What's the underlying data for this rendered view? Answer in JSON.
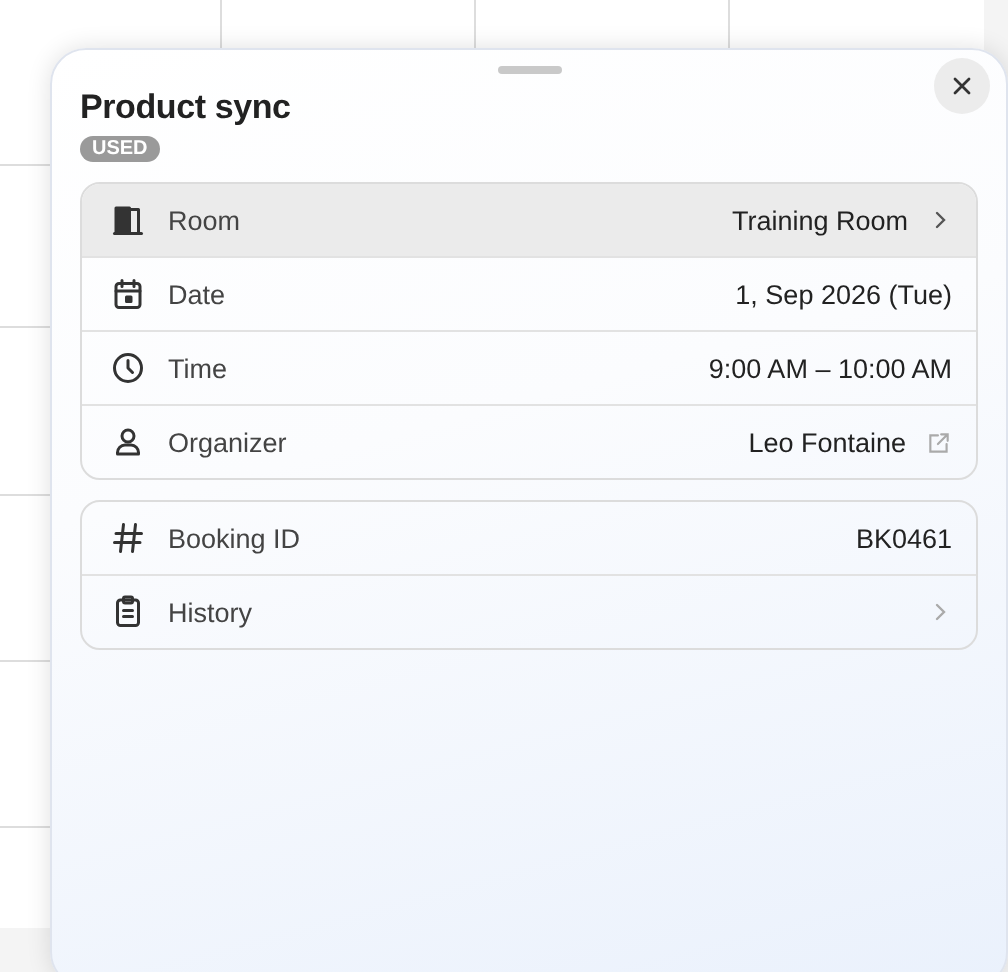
{
  "sheet": {
    "title": "Product sync",
    "badge": "USED",
    "groups": [
      {
        "rows": [
          {
            "label": "Room",
            "value": "Training Room",
            "kind": "chevron",
            "selected": true
          },
          {
            "label": "Date",
            "value": "1, Sep 2026 (Tue)",
            "selected": false
          },
          {
            "label": "Time",
            "value": "9:00 AM – 10:00 AM",
            "selected": false
          },
          {
            "label": "Organizer",
            "value": "Leo Fontaine",
            "kind": "external",
            "selected": false
          }
        ]
      },
      {
        "rows": [
          {
            "label": "Booking ID",
            "value": "BK0461",
            "selected": false
          },
          {
            "label": "History",
            "kind": "chevron",
            "selected": false
          }
        ]
      }
    ]
  }
}
